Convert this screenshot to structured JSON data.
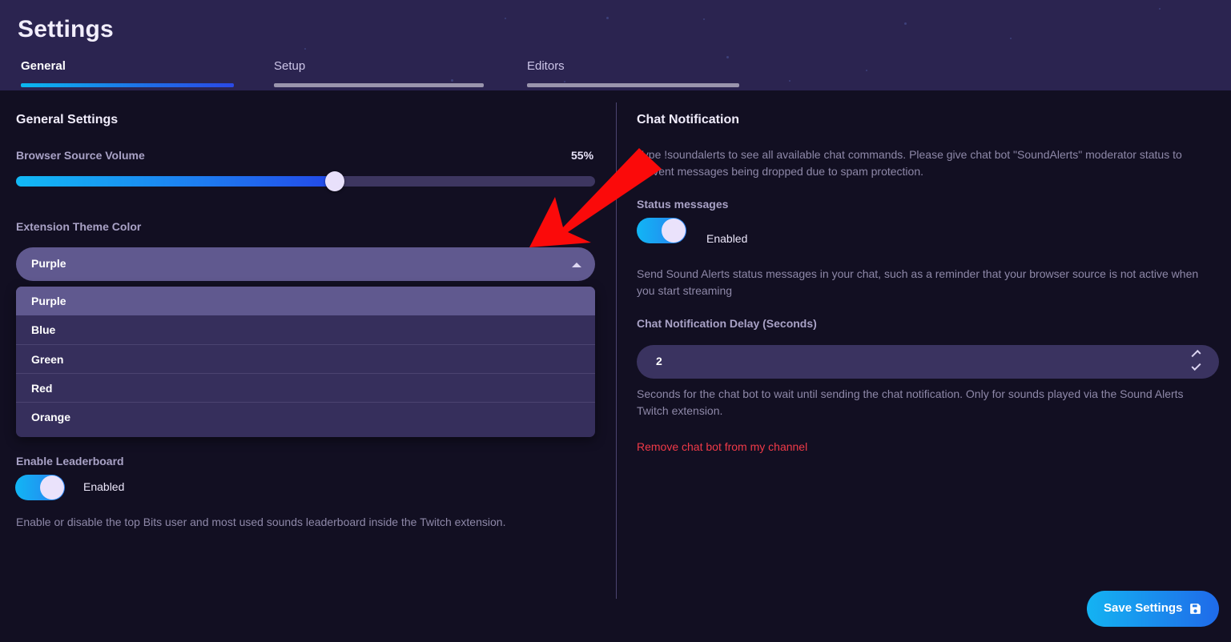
{
  "header": {
    "title": "Settings",
    "tabs": [
      {
        "label": "General",
        "active": true
      },
      {
        "label": "Setup",
        "active": false
      },
      {
        "label": "Editors",
        "active": false
      }
    ]
  },
  "left_panel": {
    "section_title": "General Settings",
    "volume": {
      "label": "Browser Source Volume",
      "value_text": "55%",
      "value": 55,
      "min": 0,
      "max": 100
    },
    "theme_color": {
      "label": "Extension Theme Color",
      "selected": "Purple",
      "caret_icon": "caret-up-icon",
      "options": [
        "Purple",
        "Blue",
        "Green",
        "Red",
        "Orange"
      ]
    },
    "leaderboard": {
      "label": "Enable Leaderboard",
      "state_text": "Enabled",
      "enabled": true,
      "help": "Enable or disable the top Bits user and most used sounds leaderboard inside the Twitch extension."
    }
  },
  "right_panel": {
    "section_title": "Chat Notification",
    "intro": "Type !soundalerts to see all available chat commands. Please give chat bot \"SoundAlerts\" moderator status to prevent messages being dropped due to spam protection.",
    "status_messages": {
      "label": "Status messages",
      "state_text": "Enabled",
      "enabled": true,
      "help": "Send Sound Alerts status messages in your chat, such as a reminder that your browser source is not active when you start streaming"
    },
    "delay": {
      "label": "Chat Notification Delay (Seconds)",
      "value": "2",
      "stepper_up_icon": "chevron-up-icon",
      "stepper_down_icon": "chevron-down-icon",
      "help": "Seconds for the chat bot to wait until sending the chat notification. Only for sounds played via the Sound Alerts Twitch extension."
    },
    "remove_bot_link": "Remove chat bot from my channel"
  },
  "footer": {
    "save_label": "Save Settings",
    "save_icon": "save-floppy-icon"
  },
  "annotation": {
    "arrow_icon": "red-arrow-pointing-down-left",
    "color": "#fb0a0a"
  },
  "colors": {
    "page_background": "#120f22",
    "header_background": "#2b2450",
    "accent_gradient_start": "#0ab8f0",
    "accent_gradient_end": "#2a49e6",
    "select_highlight": "#60598f",
    "select_menu_background": "#362f5c",
    "danger": "#f03a48"
  }
}
